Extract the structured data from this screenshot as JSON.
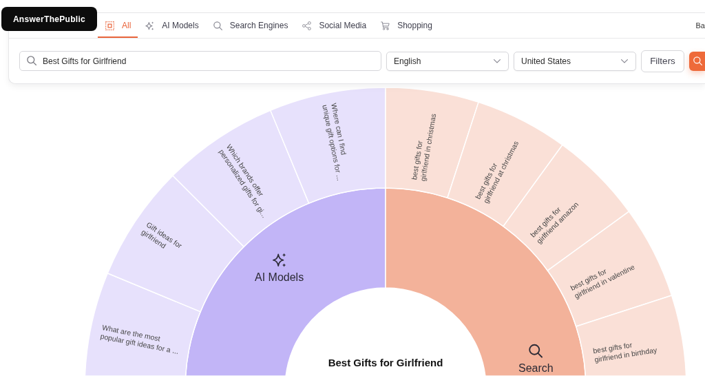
{
  "logo": {
    "text": "AnswerThePublic"
  },
  "tabs": [
    {
      "label": "All",
      "kind": "all",
      "selected": true
    },
    {
      "label": "AI Models",
      "kind": "ai",
      "selected": false
    },
    {
      "label": "Search Engines",
      "kind": "search",
      "selected": false
    },
    {
      "label": "Social Media",
      "kind": "social",
      "selected": false
    },
    {
      "label": "Shopping",
      "kind": "shopping",
      "selected": false
    }
  ],
  "header_right": {
    "text": "Ba"
  },
  "search_bar": {
    "query": {
      "value": "Best Gifts for Girlfriend"
    },
    "language_select": {
      "value": "English"
    },
    "country_select": {
      "value": "United States"
    },
    "filters_button": {
      "label": "Filters"
    }
  },
  "sunburst": {
    "center_label": "Best Gifts for Girlfriend",
    "segments": [
      {
        "label": "AI Models",
        "kind": "ai",
        "color": "#c2b5f7",
        "children": [
          {
            "label": "What are the most popular gift ideas for a ..."
          },
          {
            "label": "Gift ideas for girlfriend"
          },
          {
            "label": "Which brands offer personalized gifts for gi..."
          },
          {
            "label": "Where can I find unique gift options for ..."
          }
        ]
      },
      {
        "label": "Search",
        "kind": "search",
        "color": "#f3b29a",
        "children": [
          {
            "label": "best gifts for girlfriend in christmas"
          },
          {
            "label": "best gifts for girlfriend at christmas"
          },
          {
            "label": "best gifts for girlfriend amazon"
          },
          {
            "label": "best gifts for girlfriend in valentine"
          },
          {
            "label": "best gifts for girlfriend in birthday"
          }
        ]
      }
    ]
  }
}
